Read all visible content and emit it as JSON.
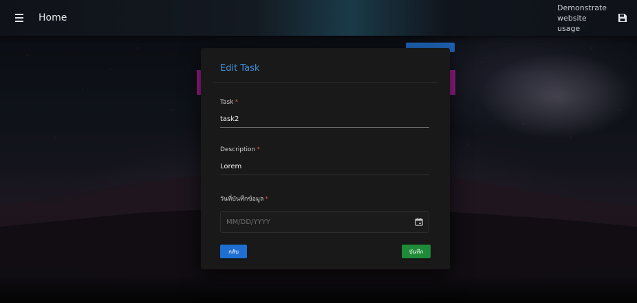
{
  "header": {
    "title": "Home",
    "demo_text": "Demonstrate website usage",
    "menu_icon": "menu-icon",
    "save_icon": "save-icon"
  },
  "dialog": {
    "title": "Edit Task",
    "fields": {
      "task": {
        "label": "Task",
        "required_mark": "*",
        "value": "task2"
      },
      "description": {
        "label": "Description",
        "required_mark": "*",
        "value": "Lorem"
      },
      "date": {
        "label": "วันที่บันทึกข้อมูล",
        "required_mark": "*",
        "placeholder": "MM/DD/YYYY",
        "icon": "calendar-icon"
      }
    },
    "buttons": {
      "back_label": "กลับ",
      "save_label": "บันทึก"
    }
  },
  "colors": {
    "accent_blue": "#1e6fd1",
    "title_blue": "#3f8fd9",
    "save_green": "#1f8a37",
    "required_red": "#d9534f",
    "dialog_bg": "#191919"
  }
}
